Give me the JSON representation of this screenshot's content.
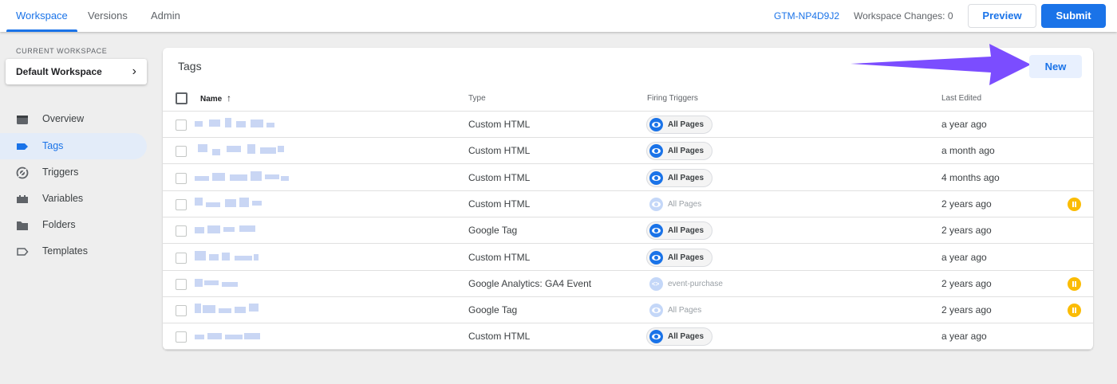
{
  "topbar": {
    "tabs": [
      {
        "label": "Workspace",
        "active": true
      },
      {
        "label": "Versions",
        "active": false
      },
      {
        "label": "Admin",
        "active": false
      }
    ],
    "container_id": "GTM-NP4D9J2",
    "workspace_changes": "Workspace Changes: 0",
    "preview_label": "Preview",
    "submit_label": "Submit"
  },
  "sidebar": {
    "current_workspace_label": "CURRENT WORKSPACE",
    "workspace_name": "Default Workspace",
    "items": [
      {
        "label": "Overview",
        "icon": "overview-icon"
      },
      {
        "label": "Tags",
        "icon": "tag-icon",
        "active": true
      },
      {
        "label": "Triggers",
        "icon": "trigger-icon"
      },
      {
        "label": "Variables",
        "icon": "variables-icon"
      },
      {
        "label": "Folders",
        "icon": "folder-icon"
      },
      {
        "label": "Templates",
        "icon": "template-icon"
      }
    ]
  },
  "tags": {
    "title": "Tags",
    "new_label": "New",
    "columns": {
      "name": "Name",
      "type": "Type",
      "triggers": "Firing Triggers",
      "edited": "Last Edited"
    },
    "rows": [
      {
        "type": "Custom HTML",
        "trigger": "All Pages",
        "edited": "a year ago",
        "paused": false
      },
      {
        "type": "Custom HTML",
        "trigger": "All Pages",
        "edited": "a month ago",
        "paused": false
      },
      {
        "type": "Custom HTML",
        "trigger": "All Pages",
        "edited": "4 months ago",
        "paused": false
      },
      {
        "type": "Custom HTML",
        "trigger": "All Pages",
        "edited": "2 years ago",
        "paused": true
      },
      {
        "type": "Google Tag",
        "trigger": "All Pages",
        "edited": "2 years ago",
        "paused": false
      },
      {
        "type": "Custom HTML",
        "trigger": "All Pages",
        "edited": "a year ago",
        "paused": false
      },
      {
        "type": "Google Analytics: GA4 Event",
        "trigger": "event-purchase",
        "edited": "2 years ago",
        "paused": true,
        "trigger_icon": "code"
      },
      {
        "type": "Google Tag",
        "trigger": "All Pages",
        "edited": "2 years ago",
        "paused": true
      },
      {
        "type": "Custom HTML",
        "trigger": "All Pages",
        "edited": "a year ago",
        "paused": false
      }
    ]
  },
  "colors": {
    "accent": "#1a73e8",
    "annotation_arrow": "#7b4dff",
    "paused_badge": "#fbbc04"
  }
}
